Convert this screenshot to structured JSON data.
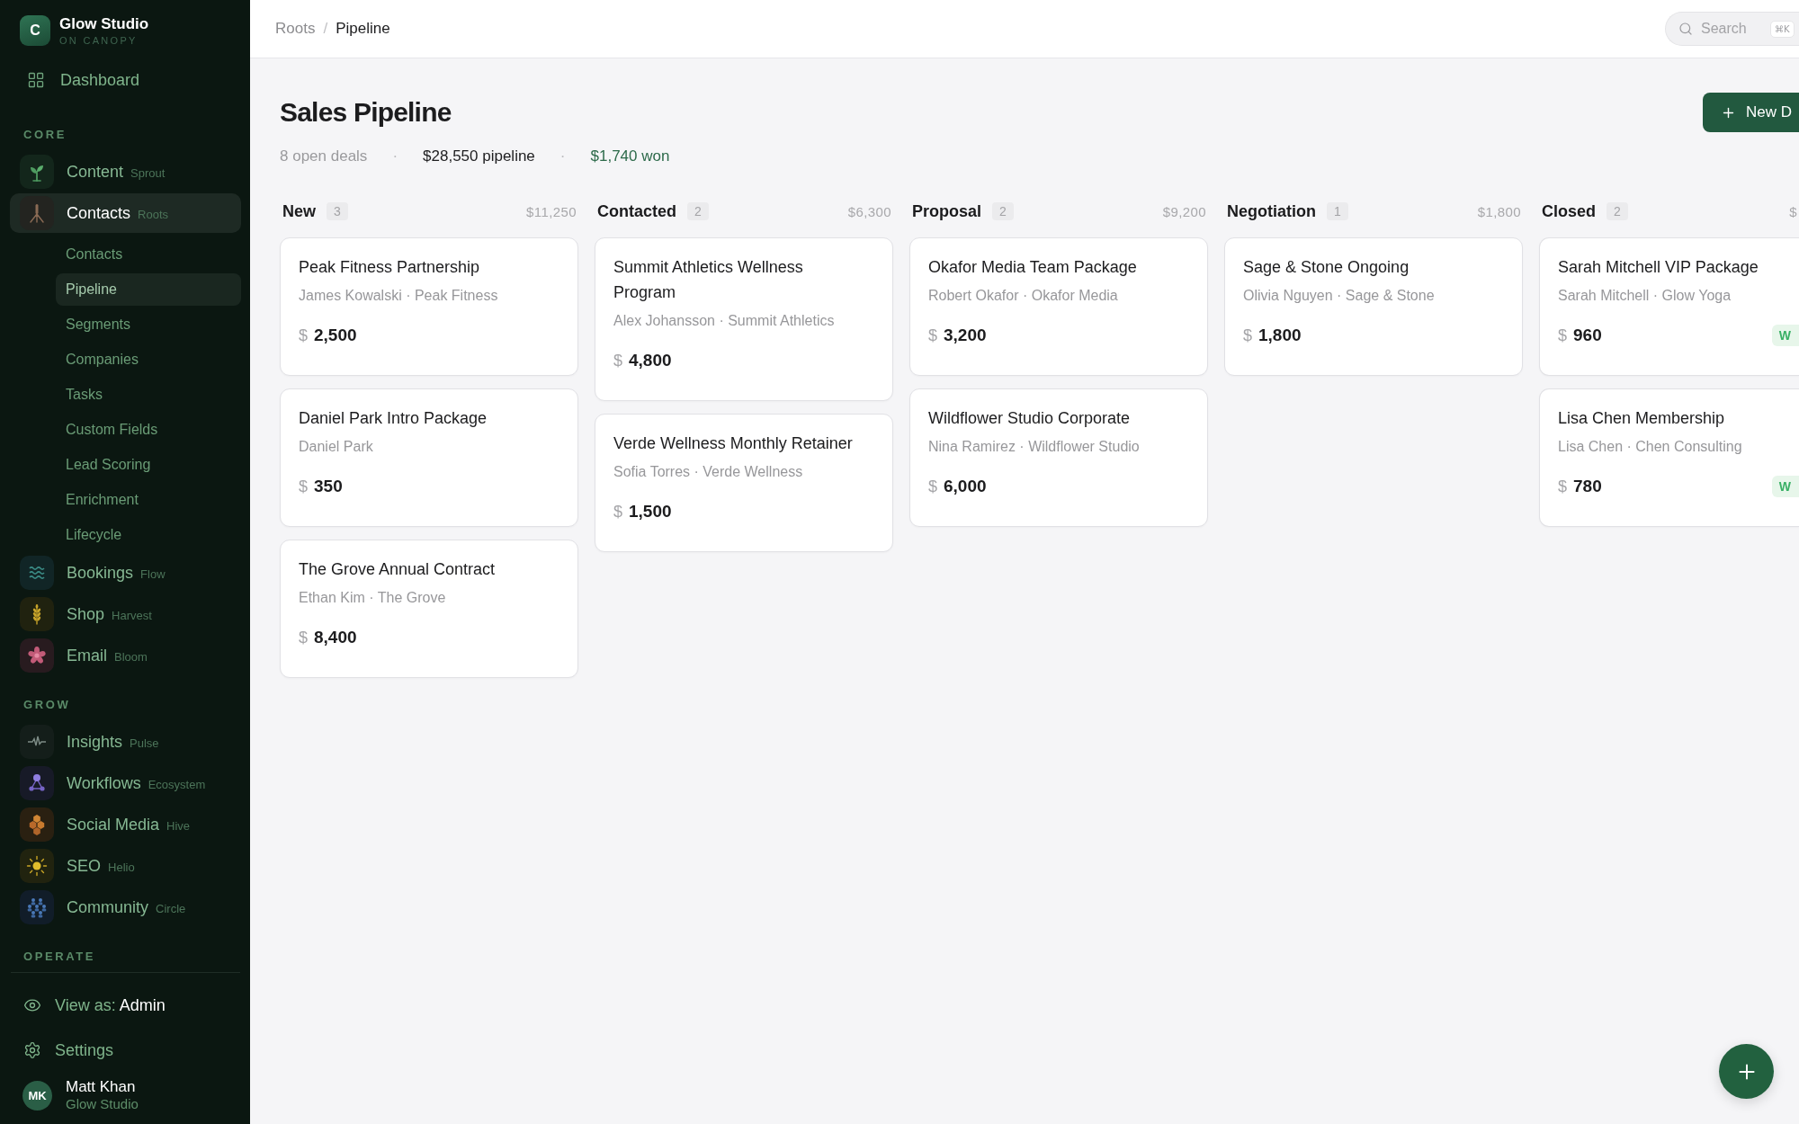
{
  "sidebar": {
    "brand": {
      "logo": "C",
      "name": "Glow Studio",
      "tagline": "ON CANOPY"
    },
    "dashboard": {
      "label": "Dashboard",
      "selected": false
    },
    "sections": [
      {
        "title": "CORE",
        "items": [
          {
            "label": "Content",
            "sublabel": "Sprout",
            "selected": false
          },
          {
            "label": "Contacts",
            "sublabel": "Roots",
            "selected": true,
            "children": [
              {
                "label": "Contacts",
                "selected": false
              },
              {
                "label": "Pipeline",
                "selected": true
              },
              {
                "label": "Segments",
                "selected": false
              },
              {
                "label": "Companies",
                "selected": false
              },
              {
                "label": "Tasks",
                "selected": false
              },
              {
                "label": "Custom Fields",
                "selected": false
              },
              {
                "label": "Lead Scoring",
                "selected": false
              },
              {
                "label": "Enrichment",
                "selected": false
              },
              {
                "label": "Lifecycle",
                "selected": false
              }
            ]
          },
          {
            "label": "Bookings",
            "sublabel": "Flow",
            "selected": false
          },
          {
            "label": "Shop",
            "sublabel": "Harvest",
            "selected": false
          },
          {
            "label": "Email",
            "sublabel": "Bloom",
            "selected": false
          }
        ]
      },
      {
        "title": "GROW",
        "items": [
          {
            "label": "Insights",
            "sublabel": "Pulse",
            "selected": false
          },
          {
            "label": "Workflows",
            "sublabel": "Ecosystem",
            "selected": false
          },
          {
            "label": "Social Media",
            "sublabel": "Hive",
            "selected": false
          },
          {
            "label": "SEO",
            "sublabel": "Helio",
            "selected": false
          },
          {
            "label": "Community",
            "sublabel": "Circle",
            "selected": false
          }
        ]
      },
      {
        "title": "OPERATE"
      }
    ],
    "view_as": {
      "label": "View as:",
      "value": "Admin"
    },
    "settings": {
      "label": "Settings"
    },
    "user": {
      "initials": "MK",
      "name": "Matt Khan",
      "org": "Glow Studio"
    }
  },
  "header": {
    "breadcrumb": [
      {
        "text": "Roots",
        "kind": "link"
      },
      {
        "text": "/",
        "kind": "separator"
      },
      {
        "text": "Pipeline",
        "kind": "current"
      }
    ],
    "search": {
      "placeholder": "Search",
      "shortcut": "⌘K"
    }
  },
  "page": {
    "title": "Sales Pipeline",
    "stats": [
      {
        "text": "8 open deals",
        "kind": "muted"
      },
      {
        "text": "·",
        "kind": "separator"
      },
      {
        "text": "$28,550 pipeline",
        "kind": "strong"
      },
      {
        "text": "·",
        "kind": "separator"
      },
      {
        "text": "$1,740 won",
        "kind": "positive"
      }
    ],
    "new_button": "New D"
  },
  "board": {
    "columns": [
      {
        "title": "New",
        "count": "3",
        "total": "$11,250",
        "cards": [
          {
            "title": "Peak Fitness Partnership",
            "meta": "James Kowalski · Peak Fitness",
            "currency": "$",
            "amount": "2,500"
          },
          {
            "title": "Daniel Park Intro Package",
            "meta": "Daniel Park",
            "currency": "$",
            "amount": "350"
          },
          {
            "title": "The Grove Annual Contract",
            "meta": "Ethan Kim · The Grove",
            "currency": "$",
            "amount": "8,400"
          }
        ]
      },
      {
        "title": "Contacted",
        "count": "2",
        "total": "$6,300",
        "cards": [
          {
            "title": "Summit Athletics Wellness Program",
            "meta": "Alex Johansson · Summit Athletics",
            "currency": "$",
            "amount": "4,800"
          },
          {
            "title": "Verde Wellness Monthly Retainer",
            "meta": "Sofia Torres · Verde Wellness",
            "currency": "$",
            "amount": "1,500"
          }
        ]
      },
      {
        "title": "Proposal",
        "count": "2",
        "total": "$9,200",
        "cards": [
          {
            "title": "Okafor Media Team Package",
            "meta": "Robert Okafor · Okafor Media",
            "currency": "$",
            "amount": "3,200"
          },
          {
            "title": "Wildflower Studio Corporate",
            "meta": "Nina Ramirez · Wildflower Studio",
            "currency": "$",
            "amount": "6,000"
          }
        ]
      },
      {
        "title": "Negotiation",
        "count": "1",
        "total": "$1,800",
        "cards": [
          {
            "title": "Sage & Stone Ongoing",
            "meta": "Olivia Nguyen · Sage & Stone",
            "currency": "$",
            "amount": "1,800"
          }
        ]
      },
      {
        "title": "Closed",
        "count": "2",
        "total": "$",
        "cards": [
          {
            "title": "Sarah Mitchell VIP Package",
            "meta": "Sarah Mitchell · Glow Yoga",
            "currency": "$",
            "amount": "960",
            "tag": "W"
          },
          {
            "title": "Lisa Chen Membership",
            "meta": "Lisa Chen · Chen Consulting",
            "currency": "$",
            "amount": "780",
            "tag": "W"
          }
        ]
      }
    ]
  }
}
